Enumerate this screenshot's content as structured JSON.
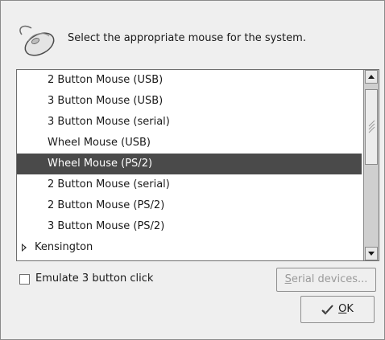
{
  "header": {
    "text": "Select the appropriate mouse for the system."
  },
  "mouse_list": {
    "items": [
      {
        "label": "2 Button Mouse (USB)",
        "selected": false
      },
      {
        "label": "3 Button Mouse (USB)",
        "selected": false
      },
      {
        "label": "3 Button Mouse (serial)",
        "selected": false
      },
      {
        "label": "Wheel Mouse (USB)",
        "selected": false
      },
      {
        "label": "Wheel Mouse (PS/2)",
        "selected": true
      },
      {
        "label": "2 Button Mouse (serial)",
        "selected": false
      },
      {
        "label": "2 Button Mouse (PS/2)",
        "selected": false
      },
      {
        "label": "3 Button Mouse (PS/2)",
        "selected": false
      }
    ],
    "group": {
      "label": "Kensington",
      "expanded": false
    }
  },
  "options": {
    "emulate_label": "Emulate 3 button click",
    "emulate_checked": false
  },
  "buttons": {
    "serial_mnemonic": "S",
    "serial_rest": "erial devices...",
    "serial_enabled": false,
    "ok_mnemonic": "O",
    "ok_rest": "K"
  },
  "colors": {
    "selection": "#4a4a4a",
    "dialog_bg": "#efefef"
  }
}
